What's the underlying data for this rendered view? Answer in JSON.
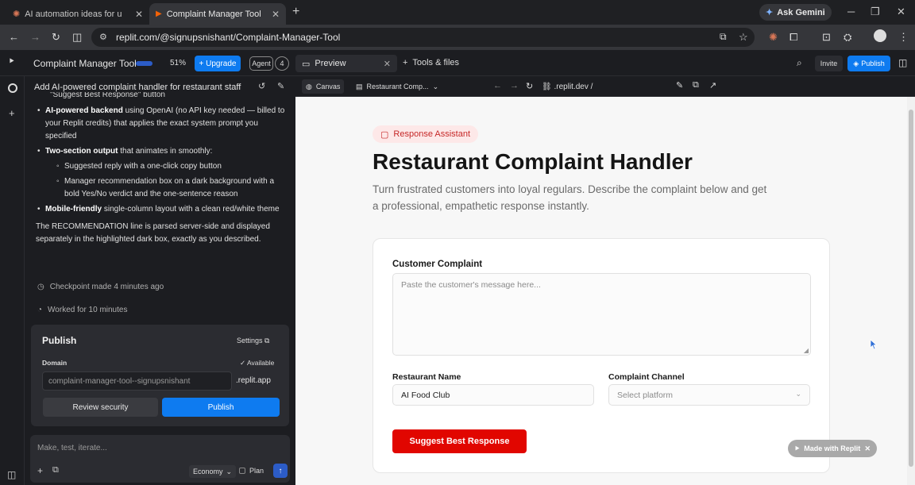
{
  "browser": {
    "tabs": [
      {
        "title": "AI automation ideas for underst",
        "active": false
      },
      {
        "title": "Complaint Manager Tool - Repli",
        "active": true
      }
    ],
    "gemini_label": "Ask Gemini",
    "url": "replit.com/@signupsnishant/Complaint-Manager-Tool"
  },
  "replit_header": {
    "project_title": "Complaint Manager Tool",
    "progress_percent_label": "51%",
    "progress_fraction": 0.51,
    "upgrade_label": "+ Upgrade",
    "agent_label": "Agent",
    "agent_count": "4",
    "preview_tab_label": "Preview",
    "tools_label": "Tools & files",
    "invite_label": "Invite",
    "publish_label": "Publish"
  },
  "agent_panel": {
    "title": "Add AI-powered complaint handler for restaurant staff",
    "cut_line": "\"Suggest Best Response\" button",
    "bullets": [
      {
        "bold": "AI-powered backend",
        "text": " using OpenAI (no API key needed — billed to your Replit credits) that applies the exact system prompt you specified"
      },
      {
        "bold": "Two-section output",
        "text": " that animates in smoothly:"
      },
      {
        "bold": "Mobile-friendly",
        "text": " single-column layout with a clean red/white theme"
      }
    ],
    "sub_bullets": [
      "Suggested reply with a one-click copy button",
      "Manager recommendation box on a dark background with a bold Yes/No verdict and the one-sentence reason"
    ],
    "paragraph": "The RECOMMENDATION line is parsed server-side and displayed separately in the highlighted dark box, exactly as you described.",
    "checkpoint": "Checkpoint made 4 minutes ago",
    "worked": "Worked for 10 minutes",
    "publish_card": {
      "title": "Publish",
      "settings": "Settings",
      "domain_label": "Domain",
      "available": "Available",
      "domain_value": "complaint-manager-tool--signupsnishant",
      "domain_suffix": ".replit.app",
      "review_label": "Review security",
      "publish_label": "Publish"
    },
    "input": {
      "placeholder": "Make, test, iterate...",
      "mode": "Economy",
      "plan_label": "Plan"
    }
  },
  "canvas_toolbar": {
    "canvas_label": "Canvas",
    "app_label": "Restaurant Comp...",
    "url": ".replit.dev /"
  },
  "page": {
    "pill": "Response Assistant",
    "title": "Restaurant Complaint Handler",
    "subtitle": "Turn frustrated customers into loyal regulars. Describe the complaint below and get a professional, empathetic response instantly.",
    "form": {
      "complaint_label": "Customer Complaint",
      "complaint_placeholder": "Paste the customer's message here...",
      "name_label": "Restaurant Name",
      "name_value": "AI Food Club",
      "channel_label": "Complaint Channel",
      "channel_placeholder": "Select platform",
      "submit_label": "Suggest Best Response"
    },
    "made_with": "Made with Replit"
  },
  "colors": {
    "accent_blue": "#0e7bf0",
    "brand_red": "#e10600",
    "dark_bg": "#1c1d21"
  }
}
